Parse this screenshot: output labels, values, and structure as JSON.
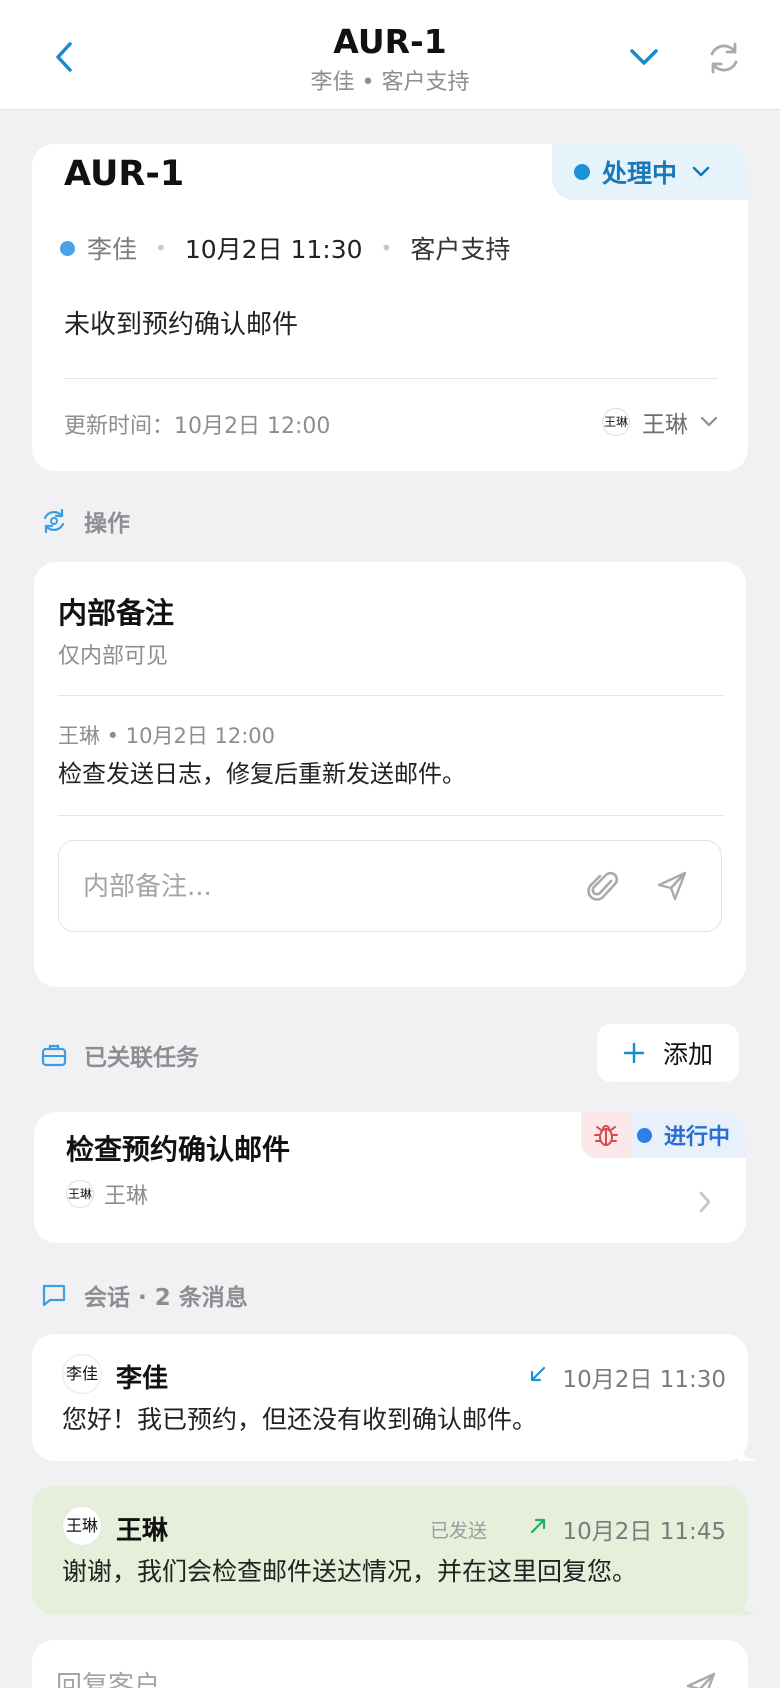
{
  "colors": {
    "accent": "#1a94d6",
    "background": "#f1f1f3",
    "outgoing_bubble": "#e5efd9",
    "bug_tag": "#fce8e8"
  },
  "header": {
    "title": "AUR-1",
    "subtitle": "李佳 • 客户支持",
    "back_icon": "chevron-left-icon",
    "expand_icon": "chevron-down-icon",
    "refresh_icon": "refresh-icon"
  },
  "ticket": {
    "id": "AUR-1",
    "status": "处理中",
    "customer": "李佳",
    "created": "10月2日 11:30",
    "team": "客户支持",
    "subject": "未收到预约确认邮件",
    "updated": "更新时间：10月2日 12:00",
    "assignee": "王琳",
    "assignee_avatar": "王琳"
  },
  "actions": {
    "title": "操作",
    "icon": "refresh-activity-icon"
  },
  "notes": {
    "title": "内部备注",
    "subtitle": "仅内部可见",
    "items": [
      {
        "meta": "王琳 • 10月2日 12:00",
        "text": "检查发送日志，修复后重新发送邮件。"
      }
    ],
    "input_placeholder": "内部备注...",
    "attach_icon": "paperclip-icon",
    "send_icon": "send-icon"
  },
  "linked_tasks": {
    "title": "已关联任务",
    "icon": "briefcase-icon",
    "add_label": "添加",
    "items": [
      {
        "title": "检查预约确认邮件",
        "assignee": "王琳",
        "avatar": "王琳",
        "status": "进行中",
        "type_icon": "bug-icon"
      }
    ]
  },
  "conversation": {
    "title": "会话 · 2 条消息",
    "icon": "chat-bubble-icon",
    "messages": [
      {
        "sender": "李佳",
        "avatar": "李佳",
        "direction": "inbound",
        "direction_icon": "arrow-down-left-icon",
        "time": "10月2日 11:30",
        "text": "您好！我已预约，但还没有收到确认邮件。"
      },
      {
        "sender": "王琳",
        "avatar": "王琳",
        "direction": "outbound",
        "direction_icon": "arrow-up-right-icon",
        "sent_label": "已发送",
        "time": "10月2日 11:45",
        "text": "谢谢，我们会检查邮件送达情况，并在这里回复您。"
      }
    ],
    "reply_placeholder": "回复客户..."
  }
}
